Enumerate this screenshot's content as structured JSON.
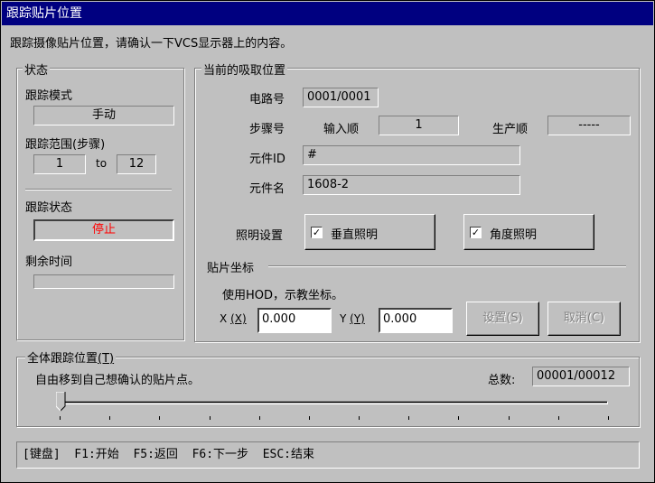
{
  "window": {
    "title": "跟踪贴片位置"
  },
  "instruction": "跟踪摄像贴片位置，请确认一下VCS显示器上的内容。",
  "status": {
    "legend": "状态",
    "tracking_mode_label": "跟踪模式",
    "tracking_mode_value": "手动",
    "tracking_range_label": "跟踪范围(步骤)",
    "range_from": "1",
    "range_to_label": "to",
    "range_to": "12",
    "tracking_state_label": "跟踪状态",
    "tracking_state_value": "停止",
    "remaining_time_label": "剩余时间",
    "remaining_time_value": ""
  },
  "pickup": {
    "legend": "当前的吸取位置",
    "circuit_label": "电路号",
    "circuit_value": "0001/0001",
    "step_label": "步骤号",
    "input_order_label": "输入顺",
    "input_order_value": "1",
    "prod_order_label": "生产顺",
    "prod_order_value": "-----",
    "component_id_label": "元件ID",
    "component_id_value": "#",
    "component_name_label": "元件名",
    "component_name_value": "1608-2",
    "lighting_label": "照明设置",
    "vertical_light_label": "垂直照明",
    "vertical_light_checked": true,
    "angle_light_label": "角度照明",
    "angle_light_checked": true
  },
  "coords": {
    "legend": "贴片坐标",
    "hint": "使用HOD，示教坐标。",
    "x_label": "X",
    "x_key": "(X)",
    "x_value": "0.000",
    "y_label": "Y",
    "y_key": "(Y)",
    "y_value": "0.000",
    "set_button": "设置(S)",
    "cancel_button": "取消(C)"
  },
  "overall": {
    "legend_text": "全体跟踪位置",
    "legend_key": "(T)",
    "hint": "自由移到自己想确认的贴片点。",
    "total_label": "总数:",
    "total_value": "00001/00012",
    "slider_position": 0.0
  },
  "statusbar": {
    "text": "[键盘]  F1:开始  F5:返回  F6:下一步  ESC:结束"
  },
  "colors": {
    "titlebar": "#000080",
    "stopped": "#ff0000",
    "face": "#c0c0c0"
  }
}
